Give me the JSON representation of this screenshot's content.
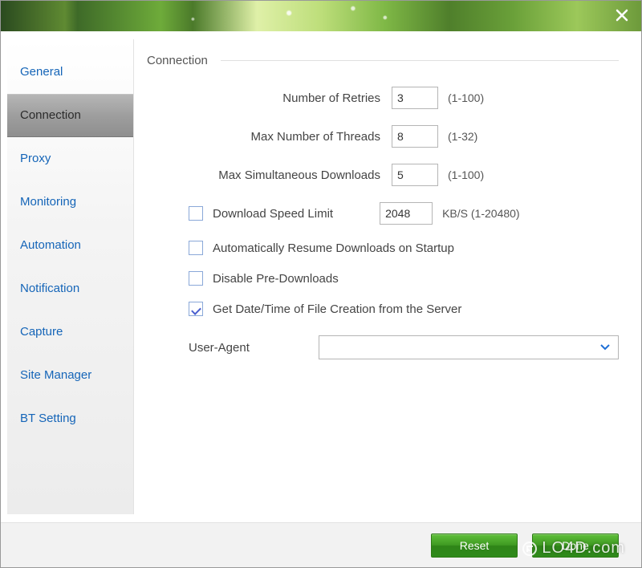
{
  "sidebar": {
    "items": [
      {
        "label": "General",
        "selected": false
      },
      {
        "label": "Connection",
        "selected": true
      },
      {
        "label": "Proxy",
        "selected": false
      },
      {
        "label": "Monitoring",
        "selected": false
      },
      {
        "label": "Automation",
        "selected": false
      },
      {
        "label": "Notification",
        "selected": false
      },
      {
        "label": "Capture",
        "selected": false
      },
      {
        "label": "Site Manager",
        "selected": false
      },
      {
        "label": "BT Setting",
        "selected": false
      }
    ]
  },
  "section": {
    "title": "Connection"
  },
  "fields": {
    "retries": {
      "label": "Number of Retries",
      "value": "3",
      "hint": "(1-100)"
    },
    "threads": {
      "label": "Max Number of Threads",
      "value": "8",
      "hint": "(1-32)"
    },
    "simul": {
      "label": "Max Simultaneous Downloads",
      "value": "5",
      "hint": "(1-100)"
    },
    "speed_limit": {
      "label": "Download Speed Limit",
      "value": "2048",
      "hint": "KB/S (1-20480)",
      "checked": false
    },
    "auto_resume": {
      "label": "Automatically Resume Downloads on Startup",
      "checked": false
    },
    "disable_pre": {
      "label": "Disable Pre-Downloads",
      "checked": false
    },
    "get_datetime": {
      "label": "Get Date/Time of File Creation from the Server",
      "checked": true
    },
    "user_agent": {
      "label": "User-Agent",
      "value": ""
    }
  },
  "footer": {
    "reset": "Reset",
    "done": "Done"
  },
  "watermark": "LO4D.com"
}
